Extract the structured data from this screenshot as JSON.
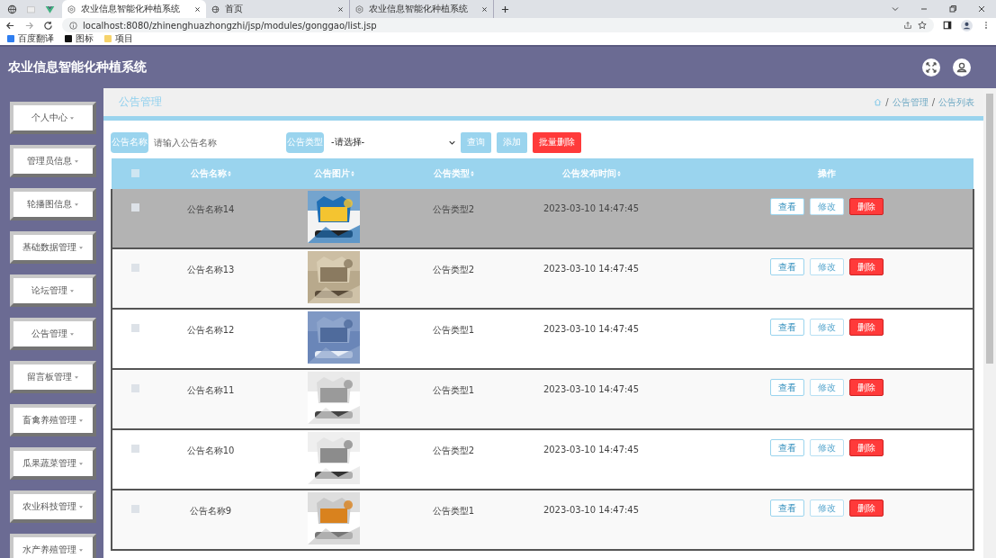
{
  "browser": {
    "tabs": [
      {
        "title": "农业信息智能化种植系统",
        "selected": true
      },
      {
        "title": "首页",
        "selected": false
      },
      {
        "title": "农业信息智能化种植系统",
        "selected": false
      }
    ],
    "address": "localhost:8080/zhinenghuazhongzhi/jsp/modules/gonggao/list.jsp",
    "bookmarks": [
      "百度翻译",
      "图标",
      "项目"
    ]
  },
  "header": {
    "title": "农业信息智能化种植系统"
  },
  "sidebar": {
    "items": [
      "个人中心",
      "管理员信息",
      "轮播图信息",
      "基础数据管理",
      "论坛管理",
      "公告管理",
      "留言板管理",
      "畜禽养殖管理",
      "瓜果蔬菜管理",
      "农业科技管理",
      "水产养殖管理"
    ]
  },
  "page": {
    "title": "公告管理",
    "breadcrumb": [
      {
        "separator": "/",
        "label": "公告管理"
      },
      {
        "separator": "/",
        "label": "公告列表"
      }
    ]
  },
  "search": {
    "name_label": "公告名称",
    "name_placeholder": "请输入公告名称",
    "type_label": "公告类型",
    "type_value": "-请选择-",
    "buttons": [
      {
        "label": "查询",
        "kind": "plain"
      },
      {
        "label": "添加",
        "kind": "plain"
      },
      {
        "label": "批量删除",
        "kind": "danger"
      }
    ]
  },
  "table": {
    "select_all_checked": false,
    "columns": [
      "公告名称",
      "公告图片",
      "公告类型",
      "公告发布时间",
      "操作"
    ],
    "rows": [
      {
        "name": "公告名称14",
        "type": "公告类型2",
        "time": "2023-03-10 14:47:45",
        "highlighted": true,
        "checked": false,
        "actions": [
          "查看",
          "修改",
          "删除"
        ]
      },
      {
        "name": "公告名称13",
        "type": "公告类型2",
        "time": "2023-03-10 14:47:45",
        "highlighted": false,
        "checked": false,
        "actions": [
          "查看",
          "修改",
          "删除"
        ]
      },
      {
        "name": "公告名称12",
        "type": "公告类型1",
        "time": "2023-03-10 14:47:45",
        "highlighted": false,
        "checked": false,
        "actions": [
          "查看",
          "修改",
          "删除"
        ]
      },
      {
        "name": "公告名称11",
        "type": "公告类型1",
        "time": "2023-03-10 14:47:45",
        "highlighted": false,
        "checked": false,
        "actions": [
          "查看",
          "修改",
          "删除"
        ]
      },
      {
        "name": "公告名称10",
        "type": "公告类型2",
        "time": "2023-03-10 14:47:45",
        "highlighted": false,
        "checked": false,
        "actions": [
          "查看",
          "修改",
          "删除"
        ]
      },
      {
        "name": "公告名称9",
        "type": "公告类型1",
        "time": "2023-03-10 14:47:45",
        "highlighted": false,
        "checked": false,
        "actions": [
          "查看",
          "修改",
          "删除"
        ]
      }
    ]
  }
}
